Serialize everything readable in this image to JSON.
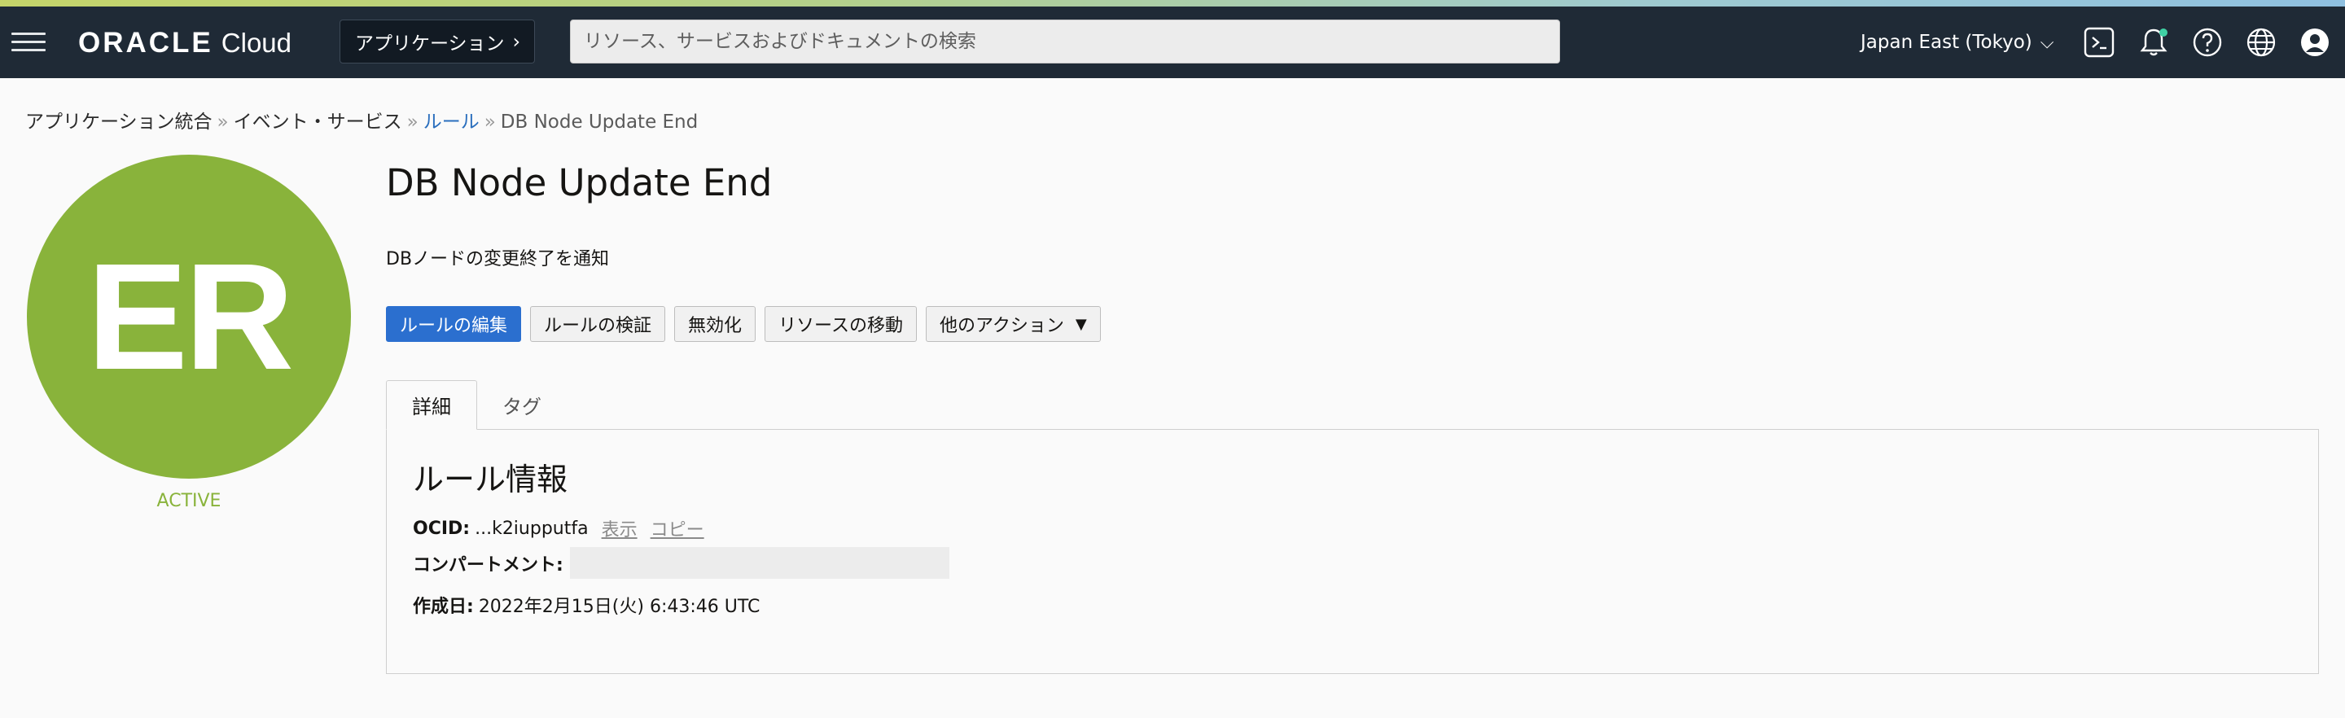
{
  "header": {
    "logo_brand": "ORACLE",
    "logo_product": "Cloud",
    "apps_label": "アプリケーション",
    "apps_chevron": "›",
    "search_placeholder": "リソース、サービスおよびドキュメントの検索",
    "region_label": "Japan East (Tokyo)",
    "region_chevron": "⌵",
    "icons": [
      "hamburger-menu-icon",
      "cloud-shell-icon",
      "bell-icon",
      "help-icon",
      "language-globe-icon",
      "profile-icon"
    ],
    "notification_dot_color": "#3fd1a4"
  },
  "breadcrumb": {
    "items": [
      "アプリケーション統合",
      "イベント・サービス",
      "ルール",
      "DB Node Update End"
    ],
    "separator": "»"
  },
  "resource": {
    "initials": "ER",
    "status": "ACTIVE",
    "status_color": "#89b33b",
    "title": "DB Node Update End",
    "description": "DBノードの変更終了を通知"
  },
  "actions": {
    "edit": "ルールの編集",
    "validate": "ルールの検証",
    "disable": "無効化",
    "move": "リソースの移動",
    "more": "他のアクション",
    "more_caret": "▼"
  },
  "tabs": {
    "details": "詳細",
    "tags": "タグ"
  },
  "rule_info": {
    "title": "ルール情報",
    "ocid_label": "OCID:",
    "ocid_value": "...k2iupputfa",
    "show_link": "表示",
    "copy_link": "コピー",
    "compartment_label": "コンパートメント:",
    "created_label": "作成日:",
    "created_value": "2022年2月15日(火) 6:43:46 UTC"
  },
  "colors": {
    "topbar": "#1f2a36",
    "primary_button": "#2b6fcf",
    "link": "#2a6ebd"
  }
}
